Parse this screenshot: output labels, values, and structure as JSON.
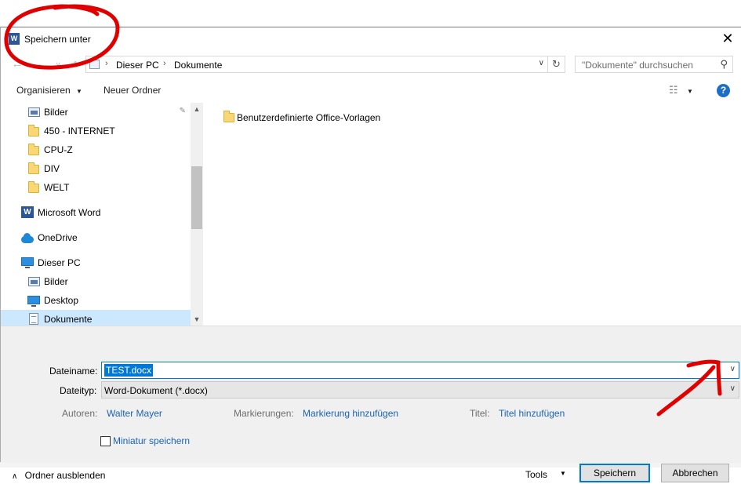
{
  "dialog": {
    "title": "Speichern unter",
    "close_label": "✕"
  },
  "nav": {
    "breadcrumb": [
      "Dieser PC",
      "Dokumente"
    ],
    "search_placeholder": "\"Dokumente\" durchsuchen"
  },
  "toolbar": {
    "organize_label": "Organisieren",
    "new_folder_label": "Neuer Ordner",
    "help_label": "?"
  },
  "sidebar": {
    "items": [
      {
        "label": "Bilder",
        "icon": "pictures-icon"
      },
      {
        "label": "450 - INTERNET",
        "icon": "folder-icon"
      },
      {
        "label": "CPU-Z",
        "icon": "folder-icon"
      },
      {
        "label": "DIV",
        "icon": "folder-icon"
      },
      {
        "label": "WELT",
        "icon": "folder-icon"
      },
      {
        "label": "Microsoft Word",
        "icon": "word-icon"
      },
      {
        "label": "OneDrive",
        "icon": "onedrive-icon"
      },
      {
        "label": "Dieser PC",
        "icon": "computer-icon"
      },
      {
        "label": "Bilder",
        "icon": "pictures-icon"
      },
      {
        "label": "Desktop",
        "icon": "desktop-icon"
      },
      {
        "label": "Dokumente",
        "icon": "documents-icon",
        "selected": true
      }
    ]
  },
  "files": [
    {
      "name": "Benutzerdefinierte Office-Vorlagen",
      "icon": "folder-icon"
    }
  ],
  "form": {
    "filename_label": "Dateiname:",
    "filename_value": "TEST.docx",
    "filetype_label": "Dateityp:",
    "filetype_value": "Word-Dokument (*.docx)",
    "authors_label": "Autoren:",
    "authors_value": "Walter Mayer",
    "tags_label": "Markierungen:",
    "tags_value": "Markierung hinzufügen",
    "title_label": "Titel:",
    "title_value": "Titel hinzufügen",
    "thumbnail_label": "Miniatur speichern",
    "hide_folders_label": "Ordner ausblenden",
    "tools_label": "Tools",
    "save_label": "Speichern",
    "cancel_label": "Abbrechen"
  },
  "colors": {
    "annotation": "#e00000",
    "selection": "#cce8ff",
    "accent": "#0078d7",
    "link": "#1b63b4"
  }
}
